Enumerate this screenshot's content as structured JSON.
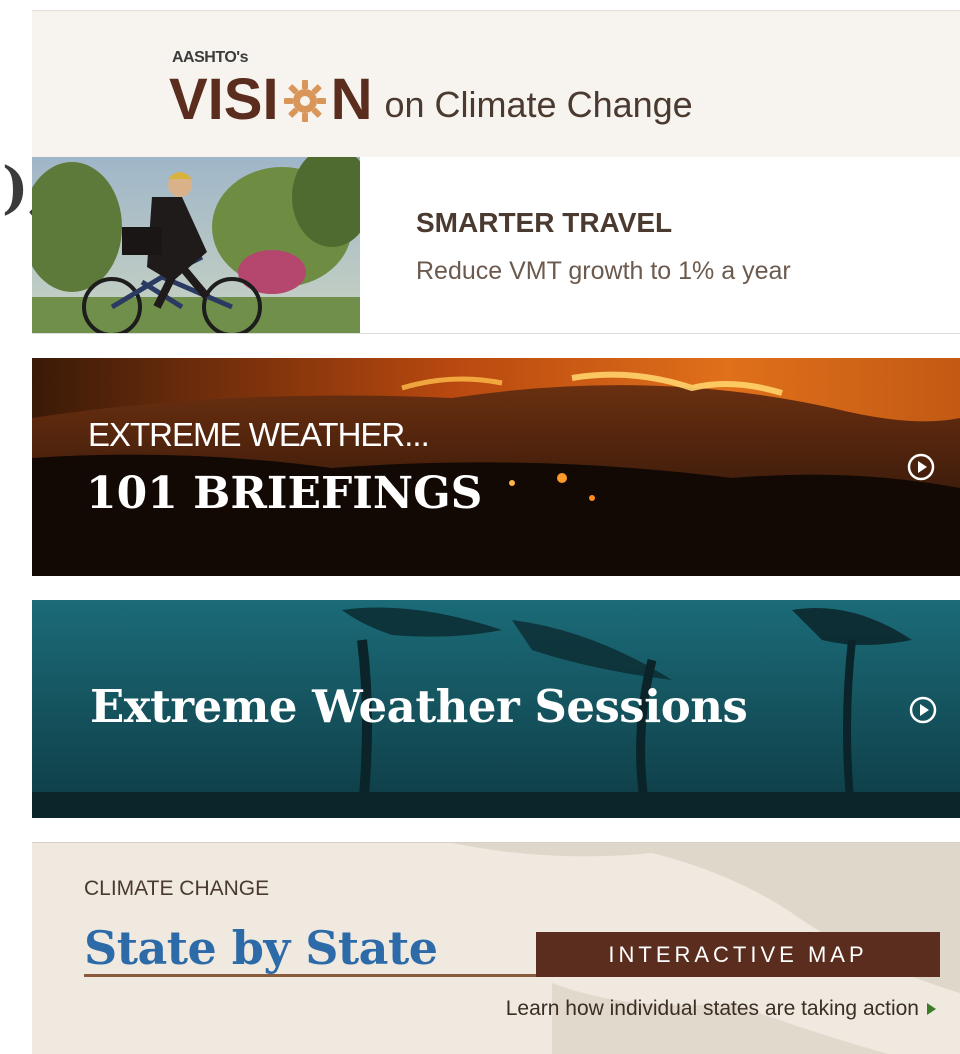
{
  "left_fragment": "),",
  "vision": {
    "pre": "AASHTO's",
    "word_start": "VISI",
    "word_end": "N",
    "tail": "on Climate Change"
  },
  "travel": {
    "title": "SMARTER TRAVEL",
    "subtitle": "Reduce VMT growth to 1% a year"
  },
  "fire": {
    "line1": "EXTREME WEATHER...",
    "line2": "101 BRIEFINGS",
    "icon": "play-circle-icon"
  },
  "storm": {
    "title": "Extreme Weather Sessions",
    "icon": "play-circle-icon"
  },
  "state": {
    "pre": "CLIMATE CHANGE",
    "main": "State by State",
    "badge": "INTERACTIVE MAP",
    "link": "Learn how individual states are taking action"
  },
  "colors": {
    "brand_brown": "#5a2d1e",
    "gear": "#d9965a",
    "state_blue": "#2d6aa8",
    "link_arrow": "#3d7a2a"
  }
}
